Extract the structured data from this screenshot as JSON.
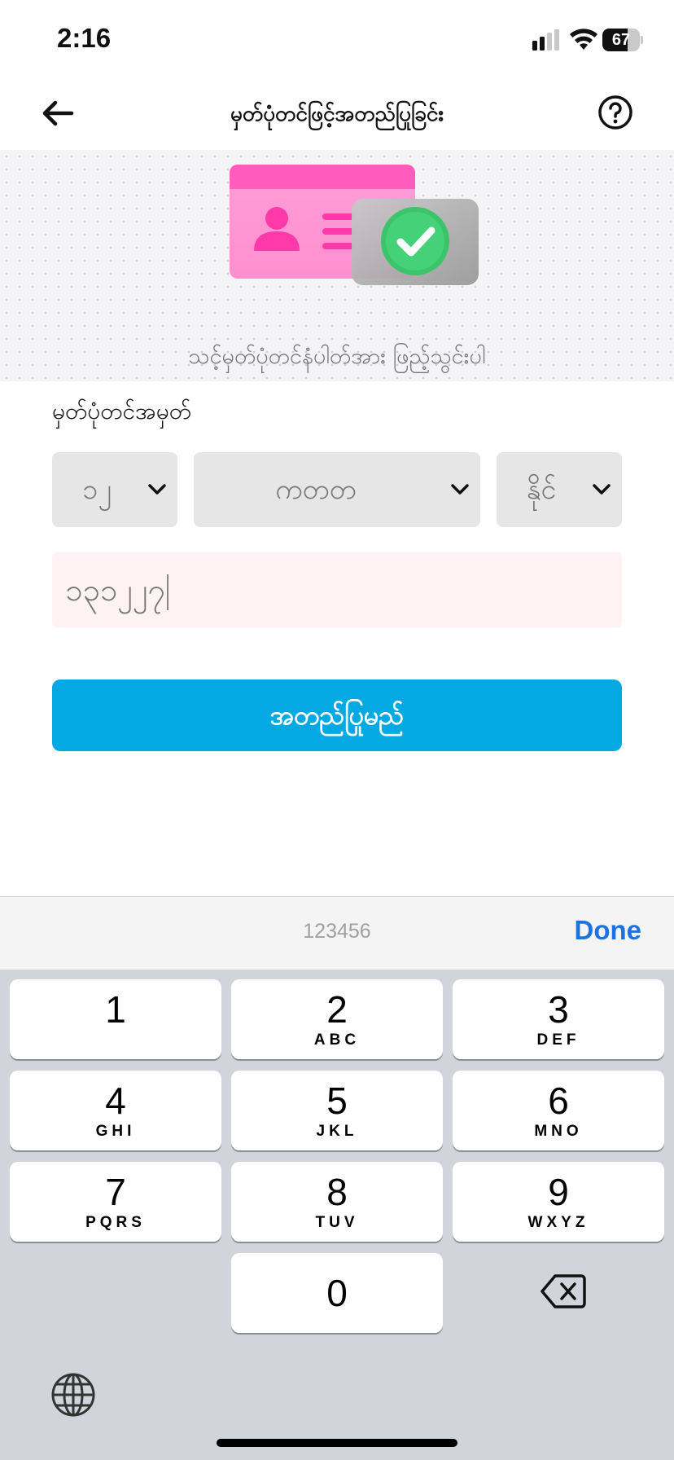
{
  "status_bar": {
    "time": "2:16",
    "battery_text": "67",
    "battery_level": 0.67
  },
  "nav": {
    "title": "မှတ်ပုံတင်ဖြင့်အတည်ပြုခြင်း",
    "back_icon": "arrow-left-icon",
    "help_icon": "question-circle-icon"
  },
  "hero": {
    "caption": "သင့်မှတ်ပုံတင်နံပါတ်အား ဖြည့်သွင်းပါ",
    "illustration": "id-card-check-illustration"
  },
  "form": {
    "label": "မှတ်ပုံတင်အမှတ်",
    "state_code": "၁၂",
    "township_code": "ကတတ",
    "citizen_type": "နိုင်",
    "nrc_number": "၁၃၁၂၂၇"
  },
  "confirm_button": {
    "label": "အတည်ပြုမည်",
    "color": "#04a9e4"
  },
  "keyboard": {
    "hint": "123456",
    "done_label": "Done",
    "keys": [
      {
        "digit": "1",
        "letters": ""
      },
      {
        "digit": "2",
        "letters": "ABC"
      },
      {
        "digit": "3",
        "letters": "DEF"
      },
      {
        "digit": "4",
        "letters": "GHI"
      },
      {
        "digit": "5",
        "letters": "JKL"
      },
      {
        "digit": "6",
        "letters": "MNO"
      },
      {
        "digit": "7",
        "letters": "PQRS"
      },
      {
        "digit": "8",
        "letters": "TUV"
      },
      {
        "digit": "9",
        "letters": "WXYZ"
      },
      {
        "digit": "0",
        "letters": ""
      }
    ],
    "delete_icon": "backspace-icon",
    "globe_icon": "globe-icon"
  }
}
